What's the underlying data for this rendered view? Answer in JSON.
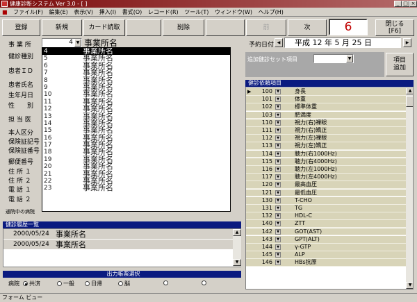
{
  "window": {
    "title": "健康診断システム Ver 3.0 - [ ]",
    "min": "_",
    "max": "□",
    "close": "×"
  },
  "menu": [
    "ファイル(F)",
    "編集(E)",
    "表示(V)",
    "挿入(I)",
    "書式(O)",
    "レコード(R)",
    "ツール(T)",
    "ウィンドウ(W)",
    "ヘルプ(H)"
  ],
  "toolbar": {
    "register": "登録",
    "new": "新規",
    "card": "カード読取",
    "delete": "削除",
    "prev": "前",
    "next": "次",
    "counter": "6",
    "close_line1": "閉じる",
    "close_line2": "[F6]"
  },
  "labels": {
    "office": "事 業 所",
    "type": "健診種別",
    "patient_id": "患者ＩＤ",
    "name": "患者氏名",
    "dob": "生年月日",
    "sex": "性　　別",
    "doctor": "担 当 医",
    "category": "本人区分",
    "ins_sym": "保険証記号",
    "ins_num": "保険証番号",
    "zip": "郵便番号",
    "addr1": "住 所 １",
    "addr2": "住 所 ２",
    "tel1": "電 話 １",
    "tel2": "電 話 ２",
    "hospital": "通院中の病院"
  },
  "office_combo": {
    "value": "4",
    "name": "事業所名"
  },
  "dropdown": {
    "rows": [
      {
        "code": "4",
        "name": "事業所名"
      },
      {
        "code": "5",
        "name": "事業所名"
      },
      {
        "code": "6",
        "name": "事業所名"
      },
      {
        "code": "7",
        "name": "事業所名"
      },
      {
        "code": "8",
        "name": "事業所名"
      },
      {
        "code": "9",
        "name": "事業所名"
      },
      {
        "code": "10",
        "name": "事業所名"
      },
      {
        "code": "11",
        "name": "事業所名"
      },
      {
        "code": "12",
        "name": "事業所名"
      },
      {
        "code": "13",
        "name": "事業所名"
      },
      {
        "code": "14",
        "name": "事業所名"
      },
      {
        "code": "15",
        "name": "事業所名"
      },
      {
        "code": "16",
        "name": "事業所名"
      },
      {
        "code": "17",
        "name": "事業所名"
      },
      {
        "code": "18",
        "name": "事業所名"
      },
      {
        "code": "19",
        "name": "事業所名"
      },
      {
        "code": "20",
        "name": "事業所名"
      },
      {
        "code": "21",
        "name": "事業所名"
      },
      {
        "code": "22",
        "name": "事業所名"
      },
      {
        "code": "23",
        "name": "事業所名"
      }
    ]
  },
  "booking": {
    "label": "予約日付",
    "date": "平成 12 年 5 月 25 日"
  },
  "set_item": {
    "label": "追加健診セット項目",
    "add_line1": "項目",
    "add_line2": "追加"
  },
  "items_header": "健診依頼項目",
  "items": [
    {
      "num": "100",
      "name": "身長"
    },
    {
      "num": "101",
      "name": "体重"
    },
    {
      "num": "102",
      "name": "標準体重"
    },
    {
      "num": "103",
      "name": "肥満度"
    },
    {
      "num": "110",
      "name": "視力(右)裸眼"
    },
    {
      "num": "111",
      "name": "視力(右)矯正"
    },
    {
      "num": "112",
      "name": "視力(左)裸眼"
    },
    {
      "num": "113",
      "name": "視力(左)矯正"
    },
    {
      "num": "114",
      "name": "聴力(右1000Hz)"
    },
    {
      "num": "115",
      "name": "聴力(右4000Hz)"
    },
    {
      "num": "116",
      "name": "聴力(左1000Hz)"
    },
    {
      "num": "117",
      "name": "聴力(左4000Hz)"
    },
    {
      "num": "120",
      "name": "最高血圧"
    },
    {
      "num": "121",
      "name": "最低血圧"
    },
    {
      "num": "130",
      "name": "T-CHO"
    },
    {
      "num": "131",
      "name": "TG"
    },
    {
      "num": "132",
      "name": "HDL-C"
    },
    {
      "num": "140",
      "name": "ZTT"
    },
    {
      "num": "142",
      "name": "GOT(AST)"
    },
    {
      "num": "143",
      "name": "GPT(ALT)"
    },
    {
      "num": "144",
      "name": "γ-GTP"
    },
    {
      "num": "145",
      "name": "ALP"
    },
    {
      "num": "146",
      "name": "HBs抗原"
    }
  ],
  "history": {
    "header": "健診履歴一覧",
    "rows": [
      {
        "date": "2000/05/24",
        "name": "事業所名"
      },
      {
        "date": "2000/05/24",
        "name": "事業所名"
      }
    ]
  },
  "output": {
    "header": "出力帳票選択",
    "prefix": "病院",
    "options": [
      "共済",
      "一般",
      "日帰",
      "脳",
      "",
      ""
    ],
    "selected": 0
  },
  "status": "フォーム ビュー"
}
